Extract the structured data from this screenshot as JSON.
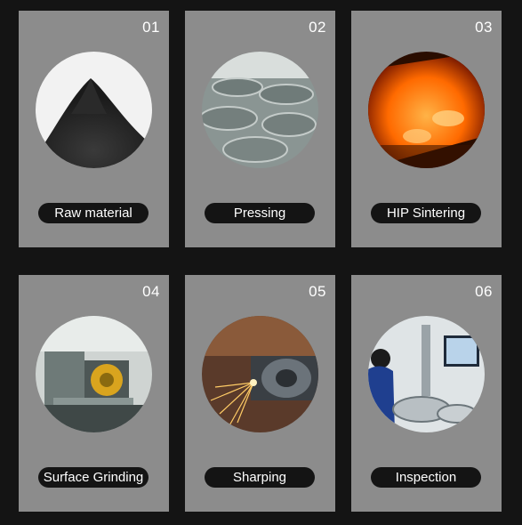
{
  "steps": [
    {
      "number": "01",
      "label": "Raw material",
      "image_icon": "powder-pile-photo"
    },
    {
      "number": "02",
      "label": "Pressing",
      "image_icon": "pressed-discs-photo"
    },
    {
      "number": "03",
      "label": "HIP Sintering",
      "image_icon": "sintering-furnace-photo"
    },
    {
      "number": "04",
      "label": "Surface Grinding",
      "image_icon": "grinding-machine-photo"
    },
    {
      "number": "05",
      "label": "Sharping",
      "image_icon": "sparks-grinding-photo"
    },
    {
      "number": "06",
      "label": "Inspection",
      "image_icon": "inspection-station-photo"
    }
  ],
  "colors": {
    "background": "#141414",
    "card": "#8c8c8c",
    "label_pill": "#141414",
    "text": "#ffffff"
  }
}
